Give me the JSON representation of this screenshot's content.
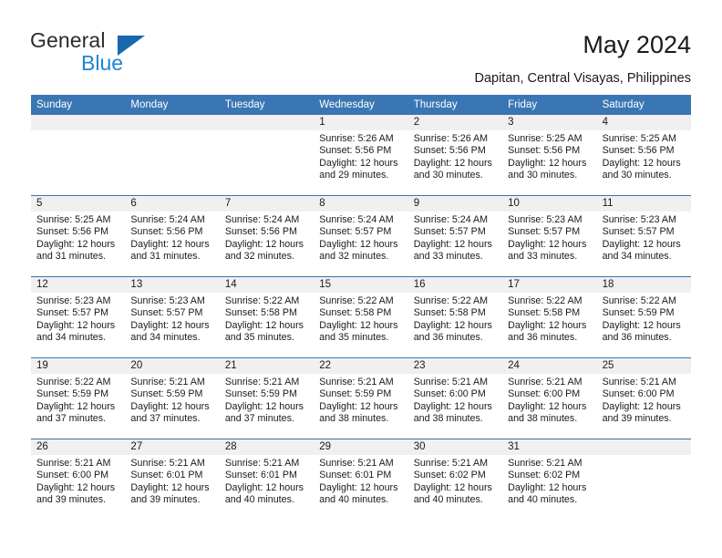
{
  "brand": {
    "word_one": "General",
    "word_two": "Blue",
    "accent_dark": "#1868B0",
    "accent_light": "#1C86D6"
  },
  "header": {
    "title": "May 2024",
    "subtitle": "Dapitan, Central Visayas, Philippines",
    "header_bg": "#3B76B4",
    "daynum_bg": "#F0F0F0"
  },
  "weekdays": [
    "Sunday",
    "Monday",
    "Tuesday",
    "Wednesday",
    "Thursday",
    "Friday",
    "Saturday"
  ],
  "weeks": [
    {
      "days": [
        {
          "num": "",
          "lines": []
        },
        {
          "num": "",
          "lines": []
        },
        {
          "num": "",
          "lines": []
        },
        {
          "num": "1",
          "lines": [
            "Sunrise: 5:26 AM",
            "Sunset: 5:56 PM",
            "Daylight: 12 hours",
            "and 29 minutes."
          ]
        },
        {
          "num": "2",
          "lines": [
            "Sunrise: 5:26 AM",
            "Sunset: 5:56 PM",
            "Daylight: 12 hours",
            "and 30 minutes."
          ]
        },
        {
          "num": "3",
          "lines": [
            "Sunrise: 5:25 AM",
            "Sunset: 5:56 PM",
            "Daylight: 12 hours",
            "and 30 minutes."
          ]
        },
        {
          "num": "4",
          "lines": [
            "Sunrise: 5:25 AM",
            "Sunset: 5:56 PM",
            "Daylight: 12 hours",
            "and 30 minutes."
          ]
        }
      ]
    },
    {
      "days": [
        {
          "num": "5",
          "lines": [
            "Sunrise: 5:25 AM",
            "Sunset: 5:56 PM",
            "Daylight: 12 hours",
            "and 31 minutes."
          ]
        },
        {
          "num": "6",
          "lines": [
            "Sunrise: 5:24 AM",
            "Sunset: 5:56 PM",
            "Daylight: 12 hours",
            "and 31 minutes."
          ]
        },
        {
          "num": "7",
          "lines": [
            "Sunrise: 5:24 AM",
            "Sunset: 5:56 PM",
            "Daylight: 12 hours",
            "and 32 minutes."
          ]
        },
        {
          "num": "8",
          "lines": [
            "Sunrise: 5:24 AM",
            "Sunset: 5:57 PM",
            "Daylight: 12 hours",
            "and 32 minutes."
          ]
        },
        {
          "num": "9",
          "lines": [
            "Sunrise: 5:24 AM",
            "Sunset: 5:57 PM",
            "Daylight: 12 hours",
            "and 33 minutes."
          ]
        },
        {
          "num": "10",
          "lines": [
            "Sunrise: 5:23 AM",
            "Sunset: 5:57 PM",
            "Daylight: 12 hours",
            "and 33 minutes."
          ]
        },
        {
          "num": "11",
          "lines": [
            "Sunrise: 5:23 AM",
            "Sunset: 5:57 PM",
            "Daylight: 12 hours",
            "and 34 minutes."
          ]
        }
      ]
    },
    {
      "days": [
        {
          "num": "12",
          "lines": [
            "Sunrise: 5:23 AM",
            "Sunset: 5:57 PM",
            "Daylight: 12 hours",
            "and 34 minutes."
          ]
        },
        {
          "num": "13",
          "lines": [
            "Sunrise: 5:23 AM",
            "Sunset: 5:57 PM",
            "Daylight: 12 hours",
            "and 34 minutes."
          ]
        },
        {
          "num": "14",
          "lines": [
            "Sunrise: 5:22 AM",
            "Sunset: 5:58 PM",
            "Daylight: 12 hours",
            "and 35 minutes."
          ]
        },
        {
          "num": "15",
          "lines": [
            "Sunrise: 5:22 AM",
            "Sunset: 5:58 PM",
            "Daylight: 12 hours",
            "and 35 minutes."
          ]
        },
        {
          "num": "16",
          "lines": [
            "Sunrise: 5:22 AM",
            "Sunset: 5:58 PM",
            "Daylight: 12 hours",
            "and 36 minutes."
          ]
        },
        {
          "num": "17",
          "lines": [
            "Sunrise: 5:22 AM",
            "Sunset: 5:58 PM",
            "Daylight: 12 hours",
            "and 36 minutes."
          ]
        },
        {
          "num": "18",
          "lines": [
            "Sunrise: 5:22 AM",
            "Sunset: 5:59 PM",
            "Daylight: 12 hours",
            "and 36 minutes."
          ]
        }
      ]
    },
    {
      "days": [
        {
          "num": "19",
          "lines": [
            "Sunrise: 5:22 AM",
            "Sunset: 5:59 PM",
            "Daylight: 12 hours",
            "and 37 minutes."
          ]
        },
        {
          "num": "20",
          "lines": [
            "Sunrise: 5:21 AM",
            "Sunset: 5:59 PM",
            "Daylight: 12 hours",
            "and 37 minutes."
          ]
        },
        {
          "num": "21",
          "lines": [
            "Sunrise: 5:21 AM",
            "Sunset: 5:59 PM",
            "Daylight: 12 hours",
            "and 37 minutes."
          ]
        },
        {
          "num": "22",
          "lines": [
            "Sunrise: 5:21 AM",
            "Sunset: 5:59 PM",
            "Daylight: 12 hours",
            "and 38 minutes."
          ]
        },
        {
          "num": "23",
          "lines": [
            "Sunrise: 5:21 AM",
            "Sunset: 6:00 PM",
            "Daylight: 12 hours",
            "and 38 minutes."
          ]
        },
        {
          "num": "24",
          "lines": [
            "Sunrise: 5:21 AM",
            "Sunset: 6:00 PM",
            "Daylight: 12 hours",
            "and 38 minutes."
          ]
        },
        {
          "num": "25",
          "lines": [
            "Sunrise: 5:21 AM",
            "Sunset: 6:00 PM",
            "Daylight: 12 hours",
            "and 39 minutes."
          ]
        }
      ]
    },
    {
      "days": [
        {
          "num": "26",
          "lines": [
            "Sunrise: 5:21 AM",
            "Sunset: 6:00 PM",
            "Daylight: 12 hours",
            "and 39 minutes."
          ]
        },
        {
          "num": "27",
          "lines": [
            "Sunrise: 5:21 AM",
            "Sunset: 6:01 PM",
            "Daylight: 12 hours",
            "and 39 minutes."
          ]
        },
        {
          "num": "28",
          "lines": [
            "Sunrise: 5:21 AM",
            "Sunset: 6:01 PM",
            "Daylight: 12 hours",
            "and 40 minutes."
          ]
        },
        {
          "num": "29",
          "lines": [
            "Sunrise: 5:21 AM",
            "Sunset: 6:01 PM",
            "Daylight: 12 hours",
            "and 40 minutes."
          ]
        },
        {
          "num": "30",
          "lines": [
            "Sunrise: 5:21 AM",
            "Sunset: 6:02 PM",
            "Daylight: 12 hours",
            "and 40 minutes."
          ]
        },
        {
          "num": "31",
          "lines": [
            "Sunrise: 5:21 AM",
            "Sunset: 6:02 PM",
            "Daylight: 12 hours",
            "and 40 minutes."
          ]
        },
        {
          "num": "",
          "lines": []
        }
      ]
    }
  ]
}
